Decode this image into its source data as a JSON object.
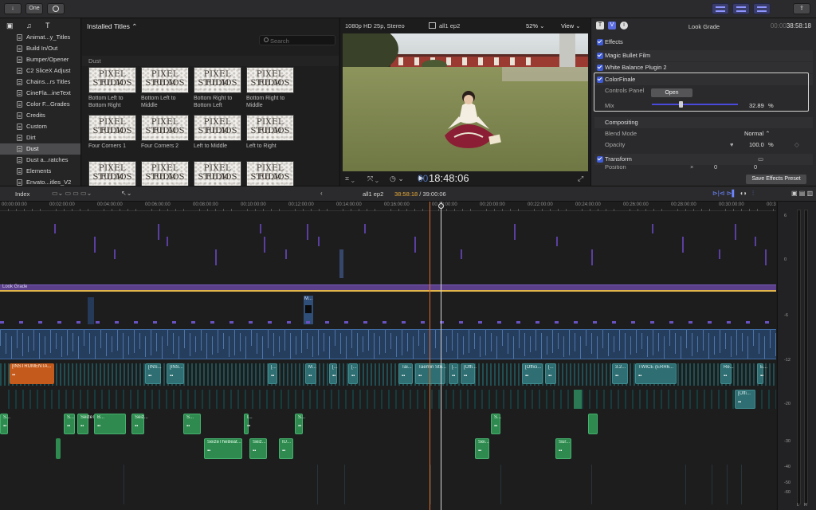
{
  "toolbar": {
    "import_icon": "download-icon",
    "keywords_label": "One",
    "bg_tasks_icon": "circle-icon",
    "share_icon": "share-icon",
    "layout_icons": [
      "browser-toggle-icon",
      "timeline-toggle-icon",
      "inspector-toggle-icon"
    ]
  },
  "sidebar": {
    "header_icons": [
      "camera-icon",
      "music-photos-icon",
      "titles-generators-icon"
    ],
    "items": [
      {
        "label": "Animat...y_Titles"
      },
      {
        "label": "Build In/Out"
      },
      {
        "label": "Bumper/Opener"
      },
      {
        "label": "C2 SliceX Adjust"
      },
      {
        "label": "Chains...rs Titles"
      },
      {
        "label": "CineFla...ineText"
      },
      {
        "label": "Color F...Grades"
      },
      {
        "label": "Credits"
      },
      {
        "label": "Custom"
      },
      {
        "label": "Dirt"
      },
      {
        "label": "Dust",
        "selected": true
      },
      {
        "label": "Dust a...ratches"
      },
      {
        "label": "Elements"
      },
      {
        "label": "Envato...itles_V2"
      }
    ]
  },
  "browser": {
    "title": "Installed Titles",
    "search_placeholder": "Search",
    "section": "Dust",
    "thumb_text_line1": "PIXEL FILM",
    "thumb_text_line2": "STUDIOS",
    "items": [
      {
        "label": "Bottom Left to Bottom Right"
      },
      {
        "label": "Bottom Left to Middle"
      },
      {
        "label": "Bottom Right to Bottom Left"
      },
      {
        "label": "Bottom Right to Middle"
      },
      {
        "label": "Four Corners 1"
      },
      {
        "label": "Four Corners 2"
      },
      {
        "label": "Left to Middle"
      },
      {
        "label": "Left to Right"
      },
      {
        "label": ""
      },
      {
        "label": ""
      },
      {
        "label": ""
      },
      {
        "label": ""
      }
    ]
  },
  "viewer": {
    "format": "1080p HD 25p, Stereo",
    "clip_name": "all1 ep2",
    "zoom": "52%",
    "view_label": "View",
    "timecode": "18:48:06",
    "timecode_prefix": "00",
    "control_icons": [
      "crop-icon",
      "transform-icon",
      "speed-icon",
      "play-icon",
      "fullscreen-icon"
    ]
  },
  "inspector": {
    "title": "Look Grade",
    "time": "38:58:18",
    "time_prefix": "00:00",
    "tabs": [
      "T",
      "V",
      "i"
    ],
    "sections": {
      "effects": "Effects",
      "magic_bullet": "Magic Bullet Film",
      "white_balance": "White Balance Plugin 2",
      "colorfinale": "ColorFinale",
      "controls_panel": "Controls Panel",
      "open_button": "Open",
      "mix": "Mix",
      "mix_value": "32.89",
      "mix_unit": "%",
      "mix_fraction": 0.33,
      "compositing": "Compositing",
      "blend_mode": "Blend Mode",
      "blend_value": "Normal",
      "opacity": "Opacity",
      "opacity_value": "100.0",
      "opacity_unit": "%",
      "transform": "Transform",
      "position": "Position",
      "position_values": [
        "0",
        "0"
      ]
    },
    "save_preset": "Save Effects Preset"
  },
  "timeline_header": {
    "index": "Index",
    "project": "all1 ep2",
    "current": "38:58:18",
    "total": "39:00:06",
    "separator": " / "
  },
  "timeline": {
    "ruler": [
      "00:00:00:00",
      "00:02:00:00",
      "00:04:00:00",
      "00:06:00:00",
      "00:08:00:00",
      "00:10:00:00",
      "00:12:00:00",
      "00:14:00:00",
      "00:16:00:00",
      "00:18:00:00",
      "00:20:00:00",
      "00:22:00:00",
      "00:24:00:00",
      "00:26:00:00",
      "00:28:00:00",
      "00:30:00:00",
      "00:32:00"
    ],
    "adjustment_layer": "Look Grade",
    "upper_clip_labels": [
      "M..."
    ],
    "teal_labels": [
      "[INS...",
      "[INS...",
      "[...",
      "M...",
      "[...",
      "[...",
      "Tai...",
      "Taemin Stri...",
      "[...",
      "[Offi...",
      "[Offici...",
      "[...",
      "3.2...",
      "TWICE (ERR6...",
      "Re...",
      "E..."
    ],
    "orange_label": "[INSTRUMENTA...",
    "teal_labels_2": [
      "[Offi..."
    ],
    "green_labels": [
      "S...",
      "S...",
      "SeizeThe...",
      "B...",
      "Seiz...",
      "S...",
      "I...",
      "S...",
      "S..."
    ],
    "green_labels_2": [
      "SeizeTheBeat...",
      "Seiz...",
      "IU...",
      "Sei...",
      "Sur..."
    ]
  },
  "meters": {
    "scale": [
      "6",
      "0",
      "-6",
      "-12",
      "-20",
      "-30",
      "-40",
      "-50",
      "-60"
    ],
    "channels": [
      "L",
      "R"
    ]
  },
  "colors": {
    "accent": "#3f5bd6",
    "playhead": "#d8d8d8",
    "skimmer": "#e36a2b",
    "adjustment": "#5b3f8b",
    "story": "#263e5e",
    "teal": "#2f6e72",
    "green": "#2e8a4e",
    "orange": "#c45a1c"
  }
}
